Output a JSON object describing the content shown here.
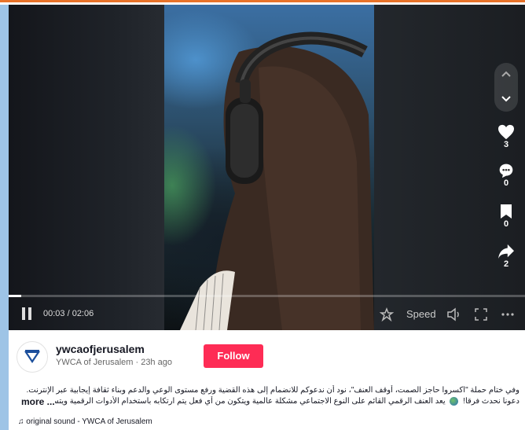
{
  "colors": {
    "accent": "#fe2c55",
    "page_background": "#9ec4e6",
    "top_stripe": "#e8732a"
  },
  "video": {
    "elapsed": "00:03",
    "duration": "02:06",
    "time_display": "00:03 / 02:06",
    "progress_fraction": 0.024,
    "state_icon": "pause-icon",
    "speed_label": "Speed"
  },
  "actions": {
    "likes": "3",
    "comments": "0",
    "saves": "0",
    "shares": "2"
  },
  "author": {
    "username": "ywcaofjerusalem",
    "display_line": "YWCA of Jerusalem · 23h ago",
    "follow_label": "Follow"
  },
  "description": {
    "line1": "وفي ختام حملة \"اكسروا حاجز الصمت، أوقف العنف\"، نود أن ندعوكم للانضمام إلى هذه القضية ورفع مستوى الوعي والدعم وبناء ثقافة إيجابية عبر الإنترنت.",
    "line2_a": "دعونا نحدث فرقا!",
    "line2_b": "يعد العنف الرقمي القائم على النوع الاجتماعي مشكلة عالمية ويتكون من أي فعل يتم ارتكابه باستخدام الأدوات الرقمية ويتسبب",
    "more_label": "more ..."
  },
  "sound": {
    "label": "original sound - YWCA of Jerusalem"
  }
}
